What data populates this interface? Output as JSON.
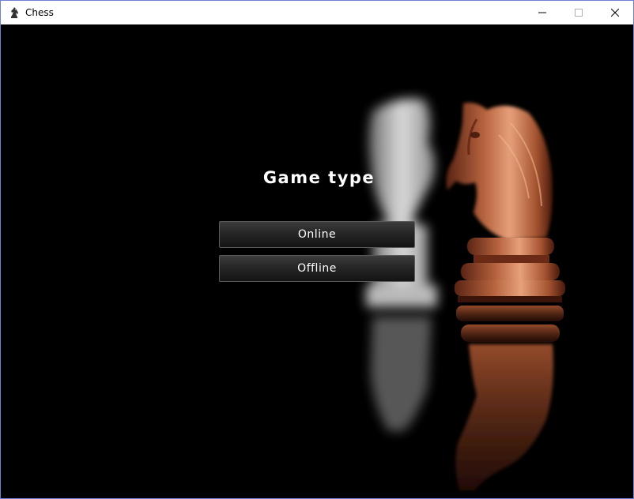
{
  "window": {
    "title": "Chess",
    "icon": "chess-knight-icon",
    "controls": [
      "minimize-icon",
      "maximize-icon",
      "close-icon"
    ]
  },
  "menu": {
    "heading": "Game type",
    "buttons": [
      {
        "label": "Online"
      },
      {
        "label": "Offline"
      }
    ]
  },
  "colors": {
    "background": "#000000",
    "button_text": "#ffffff",
    "white_knight": "#e6e6e6",
    "copper_knight": "#b86a45"
  }
}
